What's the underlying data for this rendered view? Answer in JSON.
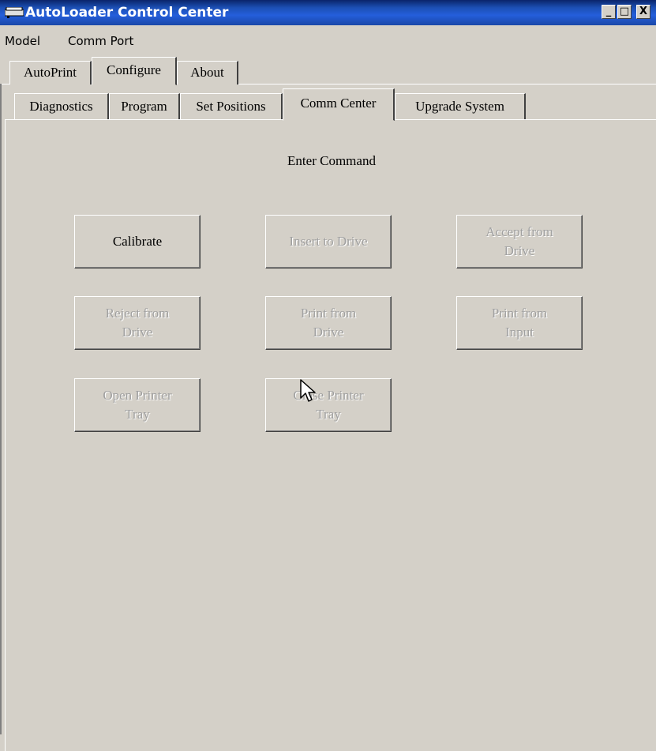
{
  "window": {
    "title": "AutoLoader Control Center",
    "controls": {
      "minimize": "_",
      "maximize": "□",
      "close": "X"
    }
  },
  "menubar": {
    "items": [
      "Model",
      "Comm Port"
    ]
  },
  "top_tabs": {
    "items": [
      "AutoPrint",
      "Configure",
      "About"
    ],
    "active": "Configure"
  },
  "sub_tabs": {
    "items": [
      "Diagnostics",
      "Program",
      "Set Positions",
      "Comm Center",
      "Upgrade System"
    ],
    "active": "Comm Center"
  },
  "comm_center": {
    "heading": "Enter Command",
    "buttons": [
      {
        "label": "Calibrate",
        "enabled": true
      },
      {
        "label": "Insert to Drive",
        "enabled": false
      },
      {
        "label": "Accept from\nDrive",
        "enabled": false
      },
      {
        "label": "Reject from\nDrive",
        "enabled": false
      },
      {
        "label": "Print from\nDrive",
        "enabled": false
      },
      {
        "label": "Print from\nInput",
        "enabled": false
      },
      {
        "label": "Open Printer\nTray",
        "enabled": false
      },
      {
        "label": "Close Printer\nTray",
        "enabled": false
      }
    ]
  }
}
